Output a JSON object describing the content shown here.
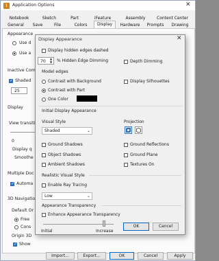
{
  "window": {
    "title": "Application Options",
    "close_glyph": "✕",
    "tabs_row1": [
      "Notebook",
      "Sketch",
      "Part",
      "iFeature",
      "Assembly",
      "Content Center"
    ],
    "tabs_row2": [
      "General",
      "Save",
      "File",
      "Colors",
      "Display",
      "Hardware",
      "Prompts",
      "Drawing"
    ],
    "selected_tab": "Display",
    "bottom_buttons": {
      "import": "Import...",
      "export": "Export...",
      "ok": "OK",
      "cancel": "Cancel",
      "apply": "Apply"
    }
  },
  "background": {
    "appearance_label": "Appearance",
    "use_doc_label": "Use d",
    "use_app_label": "Use a",
    "inactive_label": "Inactive Com",
    "shaded_label": "Shaded",
    "shaded_spin_value": "25",
    "display_label": "Display",
    "view_transition_label": "View transiti",
    "zero_label": "0",
    "display_quality_label": "Display q",
    "smoothest_label": "Smoothe",
    "multiple_docs_label": "Multiple Doc",
    "automatic_label": "Automa",
    "nav_3d_label": "3D Navigatio",
    "default_orbit_label": "Default Or",
    "free_label": "Free",
    "constrained_label": "Cons",
    "origin_label": "Origin 3D",
    "show_label": "Show"
  },
  "dialog": {
    "title": "Display Appearance",
    "close_glyph": "✕",
    "display_hidden_edges_dashed": "Display hidden edges dashed",
    "hidden_edge_dimming_value": "70",
    "hidden_edge_dimming_label": "% Hidden Edge Dimming",
    "depth_dimming_label": "Depth Dimming",
    "model_edges_label": "Model edges",
    "contrast_background_label": "Contrast with Background",
    "contrast_part_label": "Contrast with Part",
    "one_color_label": "One Color",
    "one_color_swatch": "#000000",
    "display_silhouettes_label": "Display Silhouettes",
    "initial_display_label": "Initial Display Appearance",
    "visual_style_label": "Visual Style",
    "visual_style_value": "Shaded",
    "projection_label": "Projection",
    "ground_shadows_label": "Ground Shadows",
    "object_shadows_label": "Object Shadows",
    "ambient_shadows_label": "Ambient Shadows",
    "ground_reflections_label": "Ground Reflections",
    "ground_plane_label": "Ground Plane",
    "textures_on_label": "Textures On",
    "realistic_style_label": "Realistic Visual Style",
    "enable_ray_tracing_label": "Enable Ray Tracing",
    "ray_quality_value": "Low",
    "transparency_section_label": "Appearance Transparency",
    "enhance_transparency_label": "Enhance Appearance Transparency",
    "slider_min_label": "Initial",
    "slider_max_label": "Increase",
    "ok_label": "OK",
    "cancel_label": "Cancel"
  }
}
